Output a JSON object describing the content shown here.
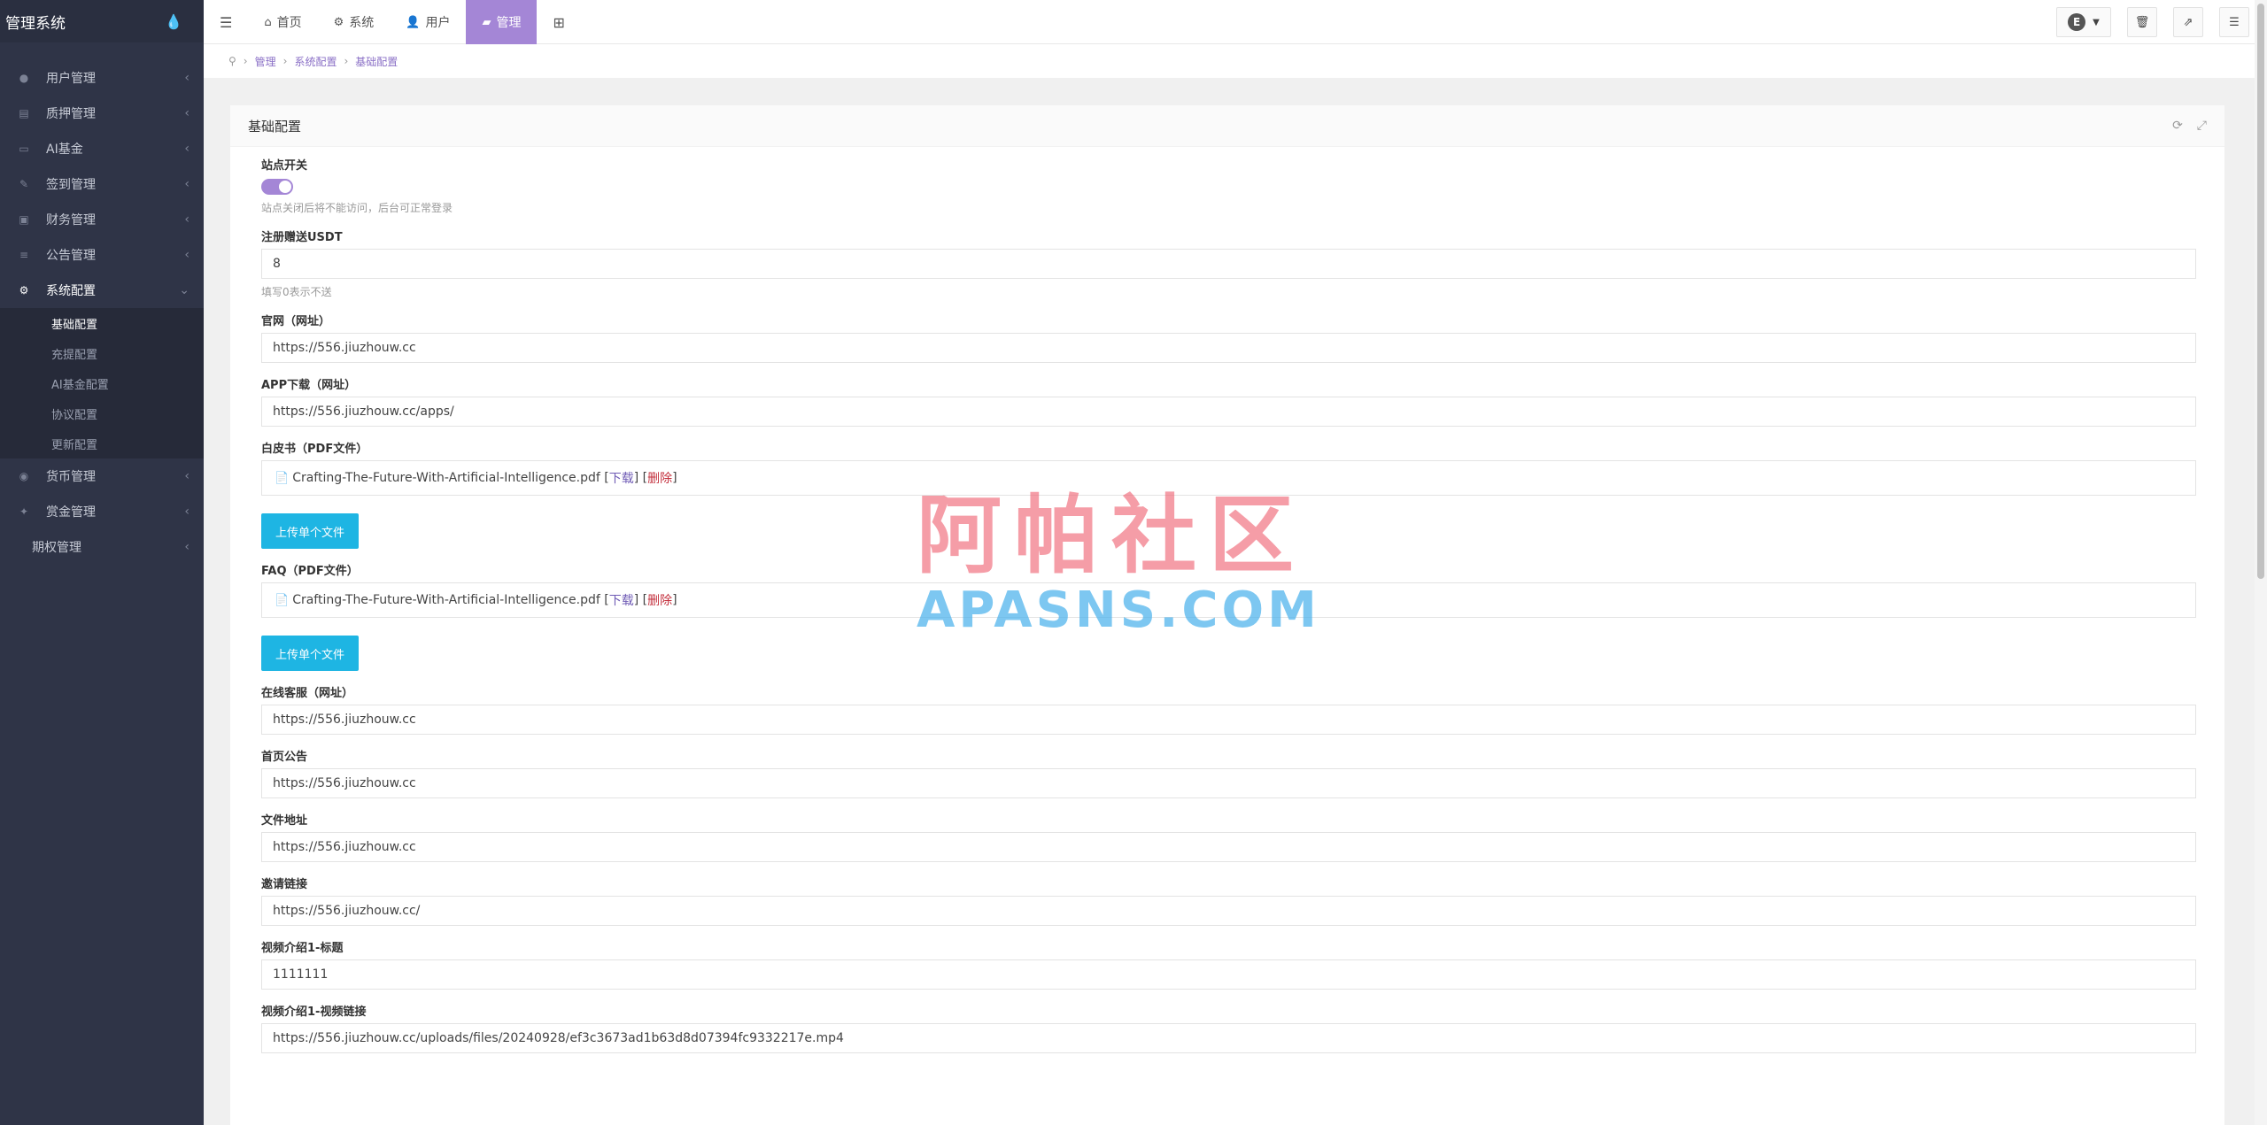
{
  "app": {
    "title": "管理系统",
    "brand_icon": "droplet-icon"
  },
  "sidebar": {
    "items": [
      {
        "label": "用户管理",
        "icon": "user-icon",
        "glyph": "👤"
      },
      {
        "label": "质押管理",
        "icon": "list-icon",
        "glyph": "▤"
      },
      {
        "label": "AI基金",
        "icon": "monitor-icon",
        "glyph": "▭"
      },
      {
        "label": "签到管理",
        "icon": "edit-icon",
        "glyph": "✎"
      },
      {
        "label": "财务管理",
        "icon": "money-icon",
        "glyph": "▣"
      },
      {
        "label": "公告管理",
        "icon": "list-icon",
        "glyph": "≡"
      },
      {
        "label": "系统配置",
        "icon": "cogs-icon",
        "glyph": "⚙"
      },
      {
        "label": "货币管理",
        "icon": "coin-icon",
        "glyph": "◉"
      },
      {
        "label": "赏金管理",
        "icon": "bounty-icon",
        "glyph": "✦"
      },
      {
        "label": "期权管理"
      }
    ],
    "submenu": [
      "基础配置",
      "充提配置",
      "AI基金配置",
      "协议配置",
      "更新配置"
    ]
  },
  "topbar": {
    "home": "首页",
    "system": "系统",
    "user": "用户",
    "manage": "管理",
    "avatar_letter": "E"
  },
  "breadcrumb": {
    "l1": "管理",
    "l2": "系统配置",
    "l3": "基础配置"
  },
  "panel": {
    "title": "基础配置",
    "site_switch_label": "站点开关",
    "site_switch_help": "站点关闭后将不能访问，后台可正常登录",
    "site_switch_on": true,
    "register_label": "注册赠送USDT",
    "register_value": "8",
    "register_help": "填写0表示不送",
    "website_label": "官网（网址）",
    "website_value": "https://556.jiuzhouw.cc",
    "app_label": "APP下载（网址）",
    "app_value": "https://556.jiuzhouw.cc/apps/",
    "whitepaper_label": "白皮书（PDF文件）",
    "whitepaper_file": "Crafting-The-Future-With-Artificial-Intelligence.pdf",
    "faq_label": "FAQ（PDF文件）",
    "faq_file": "Crafting-The-Future-With-Artificial-Intelligence.pdf",
    "download_text": "下载",
    "delete_text": "删除",
    "upload_btn": "上传单个文件",
    "service_label": "在线客服（网址）",
    "service_value": "https://556.jiuzhouw.cc",
    "notice_label": "首页公告",
    "notice_value": "https://556.jiuzhouw.cc",
    "fileaddr_label": "文件地址",
    "fileaddr_value": "https://556.jiuzhouw.cc",
    "invite_label": "邀请链接",
    "invite_value": "https://556.jiuzhouw.cc/",
    "video1_title_label": "视频介绍1-标题",
    "video1_title_value": "1111111",
    "video1_link_label": "视频介绍1-视频链接",
    "video1_link_value": "https://556.jiuzhouw.cc/uploads/files/20240928/ef3c3673ad1b63d8d07394fc9332217e.mp4"
  },
  "watermark": {
    "cn": "阿帕社区",
    "en": "APASNS.COM"
  }
}
